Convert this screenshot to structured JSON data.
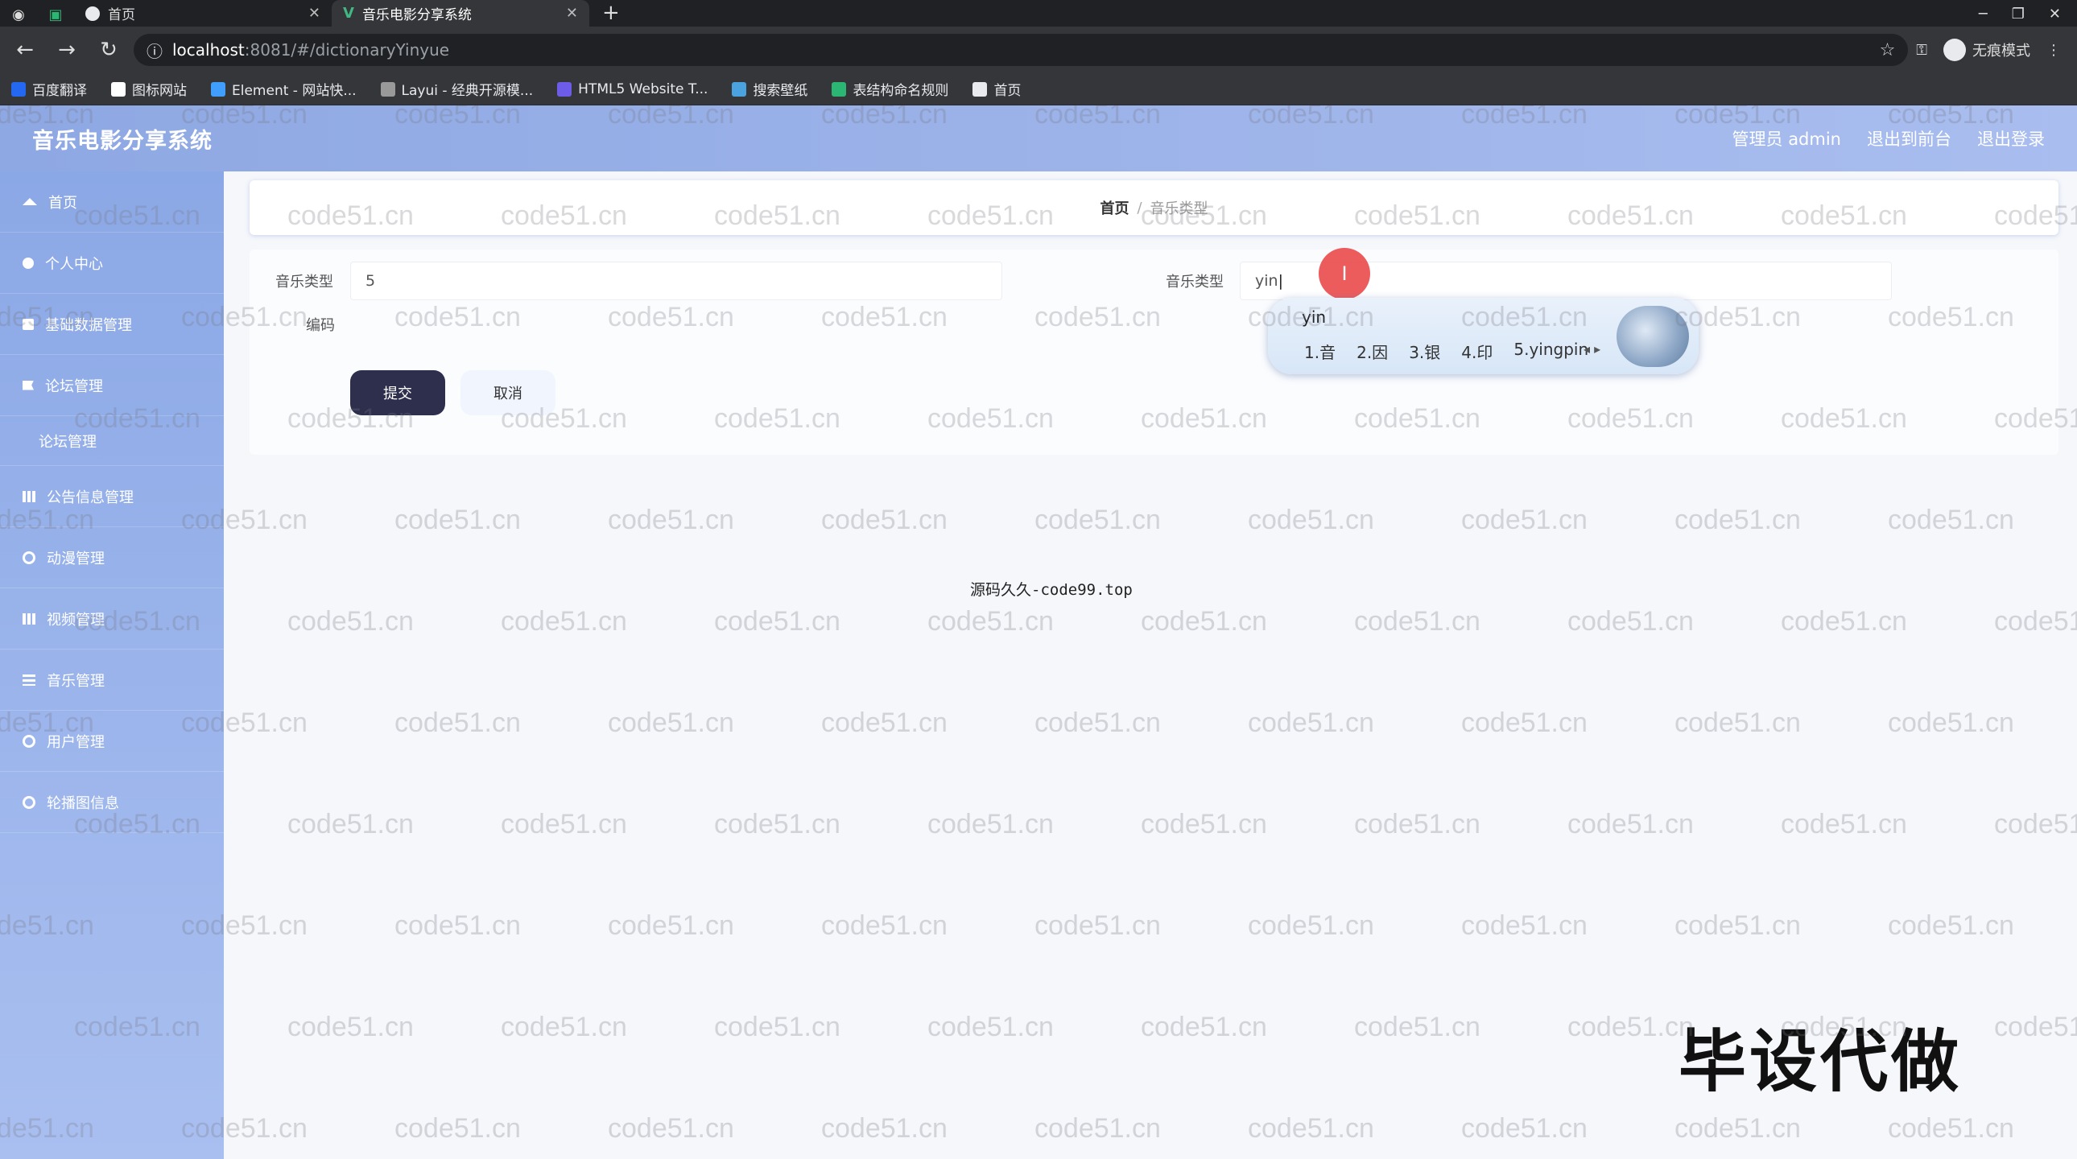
{
  "browser": {
    "tabs": [
      {
        "label": "首页",
        "active": false
      },
      {
        "label": "音乐电影分享系统",
        "active": true
      }
    ],
    "url_host": "localhost",
    "url_path": ":8081/#/dictionaryYinyue",
    "incognito_label": "无痕模式",
    "bookmarks": [
      {
        "label": "百度翻译",
        "color": "#2468f2"
      },
      {
        "label": "图标网站",
        "color": "#ffffff"
      },
      {
        "label": "Element - 网站快...",
        "color": "#409eff"
      },
      {
        "label": "Layui - 经典开源模...",
        "color": "#999999"
      },
      {
        "label": "HTML5 Website T...",
        "color": "#6c5ce7"
      },
      {
        "label": "搜索壁纸",
        "color": "#4aa3df"
      },
      {
        "label": "表结构命名规则",
        "color": "#2bb673"
      },
      {
        "label": "首页",
        "color": "#e8eaed"
      }
    ]
  },
  "header": {
    "title": "音乐电影分享系统",
    "admin_label": "管理员 admin",
    "back_front_label": "退出到前台",
    "logout_label": "退出登录"
  },
  "sidebar": {
    "items": [
      {
        "label": "首页",
        "icon": "home-icon"
      },
      {
        "label": "个人中心",
        "icon": "user-icon"
      },
      {
        "label": "基础数据管理",
        "icon": "square-icon"
      },
      {
        "label": "论坛管理",
        "icon": "flag-icon"
      },
      {
        "label": "论坛管理",
        "icon": "",
        "sub": true
      },
      {
        "label": "公告信息管理",
        "icon": "bar-icon"
      },
      {
        "label": "动漫管理",
        "icon": "circle-icon"
      },
      {
        "label": "视频管理",
        "icon": "bar-icon"
      },
      {
        "label": "音乐管理",
        "icon": "lines-icon"
      },
      {
        "label": "用户管理",
        "icon": "circle-icon"
      },
      {
        "label": "轮播图信息",
        "icon": "circle-icon"
      }
    ]
  },
  "breadcrumb": {
    "home": "首页",
    "separator": "/",
    "current": "音乐类型"
  },
  "form": {
    "code_label": "音乐类型",
    "code_sub_label": "编码",
    "code_value": "5",
    "name_label": "音乐类型",
    "name_value": "yin",
    "submit_label": "提交",
    "cancel_label": "取消"
  },
  "ime": {
    "composition": "yin",
    "candidates": [
      "1.音",
      "2.因",
      "3.银",
      "4.印",
      "5.yingpin"
    ],
    "arrows": "◂ ▸"
  },
  "cursor_glyph": "I",
  "footer_source": "源码久久-code99.top",
  "corner_watermark": "毕设代做",
  "watermark_text": "code51.cn"
}
